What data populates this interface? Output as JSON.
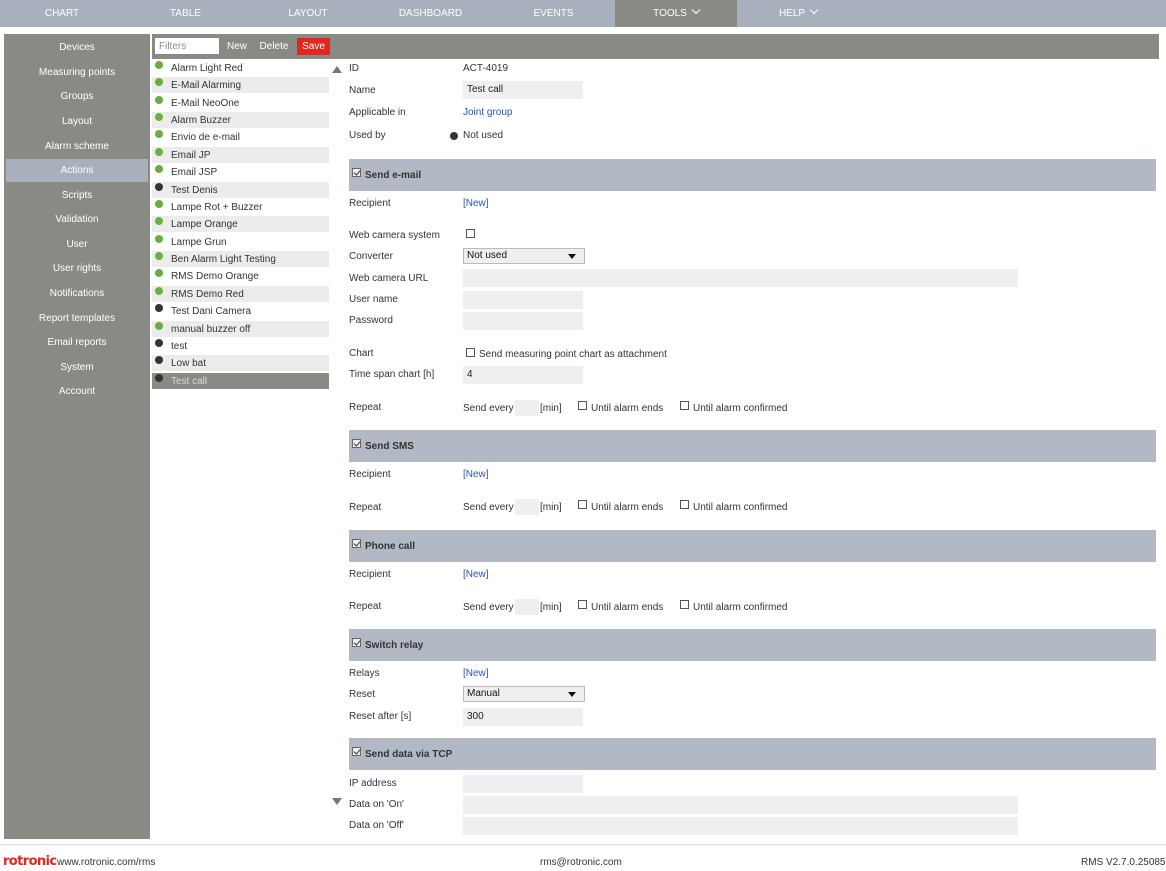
{
  "top_nav": {
    "tabs": [
      {
        "label": "CHART"
      },
      {
        "label": "TABLE"
      },
      {
        "label": "LAYOUT"
      },
      {
        "label": "DASHBOARD"
      },
      {
        "label": "EVENTS"
      },
      {
        "label": "TOOLS"
      },
      {
        "label": "HELP"
      }
    ],
    "active": "TOOLS"
  },
  "sidebar": {
    "items": [
      {
        "label": "Devices"
      },
      {
        "label": "Measuring points"
      },
      {
        "label": "Groups"
      },
      {
        "label": "Layout"
      },
      {
        "label": "Alarm scheme"
      },
      {
        "label": "Actions"
      },
      {
        "label": "Scripts"
      },
      {
        "label": "Validation"
      },
      {
        "label": "User"
      },
      {
        "label": "User rights"
      },
      {
        "label": "Notifications"
      },
      {
        "label": "Report templates"
      },
      {
        "label": "Email reports"
      },
      {
        "label": "System"
      },
      {
        "label": "Account"
      }
    ],
    "active": "Actions"
  },
  "toolbar": {
    "filter_placeholder": "Filters",
    "new_label": "New",
    "delete_label": "Delete",
    "save_label": "Save"
  },
  "actions": [
    {
      "label": "Alarm Light Red",
      "status": "green"
    },
    {
      "label": "E-Mail Alarming",
      "status": "green"
    },
    {
      "label": "E-Mail NeoOne",
      "status": "green"
    },
    {
      "label": "Alarm Buzzer",
      "status": "green"
    },
    {
      "label": "Envio de e-mail",
      "status": "green"
    },
    {
      "label": "Email JP",
      "status": "green"
    },
    {
      "label": "Email JSP",
      "status": "green"
    },
    {
      "label": "Test Denis",
      "status": "black"
    },
    {
      "label": "Lampe Rot + Buzzer",
      "status": "green"
    },
    {
      "label": "Lampe Orange",
      "status": "green"
    },
    {
      "label": "Lampe Grun",
      "status": "green"
    },
    {
      "label": "Ben Alarm Light Testing",
      "status": "green"
    },
    {
      "label": "RMS Demo Orange",
      "status": "green"
    },
    {
      "label": "RMS Demo Red",
      "status": "green"
    },
    {
      "label": "Test Dani Camera",
      "status": "black"
    },
    {
      "label": "manual buzzer off",
      "status": "green"
    },
    {
      "label": "test",
      "status": "black"
    },
    {
      "label": "Low bat",
      "status": "black"
    },
    {
      "label": "Test call",
      "status": "black"
    }
  ],
  "selected_action": "Test call",
  "detail": {
    "id_label": "ID",
    "id_value": "ACT-4019",
    "name_label": "Name",
    "name_value": "Test call",
    "applicable_label": "Applicable in",
    "applicable_value": "Joint group",
    "usedby_label": "Used by",
    "usedby_value": "Not used",
    "new_link": "[New]",
    "recipient_label": "Recipient",
    "repeat_label": "Repeat",
    "send_every_label": "Send every",
    "min_label": "[min]",
    "until_alarm_ends_label": "Until alarm ends",
    "until_alarm_confirmed_label": "Until alarm confirmed",
    "email": {
      "title": "Send e-mail",
      "webcam_label": "Web camera system",
      "webcam_checked": false,
      "converter_label": "Converter",
      "converter_value": "Not used",
      "webcam_url_label": "Web camera URL",
      "username_label": "User name",
      "password_label": "Password",
      "chart_label": "Chart",
      "chart_attach_label": "Send measuring point chart as attachment",
      "timespan_label": "Time span chart [h]",
      "timespan_value": "4"
    },
    "sms": {
      "title": "Send SMS"
    },
    "phone": {
      "title": "Phone call"
    },
    "relay": {
      "title": "Switch relay",
      "relays_label": "Relays",
      "reset_label": "Reset",
      "reset_value": "Manual",
      "reset_after_label": "Reset after [s]",
      "reset_after_value": "300"
    },
    "tcp": {
      "title": "Send data via TCP",
      "ip_label": "IP address",
      "data_on_label": "Data on 'On'",
      "data_off_label": "Data on 'Off'"
    }
  },
  "footer": {
    "logo": "rotronic",
    "website": "www.rotronic.com/rms",
    "email": "rms@rotronic.com",
    "version": "RMS V2.7.0.25085"
  },
  "colors": {
    "nav_bg": "#a8b0bd",
    "sidebar_bg": "#8a8a84",
    "save_bg": "#e3271f",
    "status_green": "#6cae3e",
    "status_black": "#333333",
    "section_bg": "#b3b9c4",
    "link": "#2a52be"
  }
}
